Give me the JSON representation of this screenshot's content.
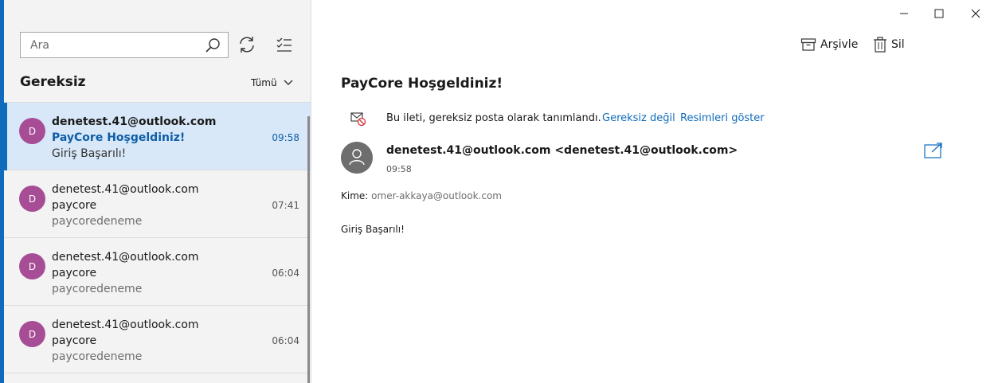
{
  "search": {
    "placeholder": "Ara"
  },
  "folder": {
    "title": "Gereksiz",
    "filter_label": "Tümü"
  },
  "messages": [
    {
      "avatar_letter": "D",
      "sender": "denetest.41@outlook.com",
      "subject": "PayCore Hoşgeldiniz!",
      "preview": "Giriş Başarılı!",
      "time": "09:58",
      "selected": true
    },
    {
      "avatar_letter": "D",
      "sender": "denetest.41@outlook.com",
      "subject": "paycore",
      "preview": "paycoredeneme",
      "time": "07:41",
      "selected": false
    },
    {
      "avatar_letter": "D",
      "sender": "denetest.41@outlook.com",
      "subject": "paycore",
      "preview": "paycoredeneme",
      "time": "06:04",
      "selected": false
    },
    {
      "avatar_letter": "D",
      "sender": "denetest.41@outlook.com",
      "subject": "paycore",
      "preview": "paycoredeneme",
      "time": "06:04",
      "selected": false
    }
  ],
  "toolbar": {
    "archive_label": "Arşivle",
    "delete_label": "Sil"
  },
  "reading": {
    "subject": "PayCore Hoşgeldiniz!",
    "junk_notice": "Bu ileti, gereksiz posta olarak tanımlandı.",
    "not_junk_link": "Gereksiz değil",
    "show_images_link": "Resimleri göster",
    "sender_line": "denetest.41@outlook.com <denetest.41@outlook.com>",
    "time": "09:58",
    "to_label": "Kime:",
    "to_address": "omer-akkaya@outlook.com",
    "body": "Giriş Başarılı!"
  },
  "colors": {
    "accent": "#0f6cbd",
    "selected_bg": "#d8e8f8",
    "avatar": "#a64d96"
  },
  "icons": [
    "search-icon",
    "refresh-icon",
    "select-mode-icon",
    "chevron-down-icon",
    "minimize-icon",
    "maximize-icon",
    "close-icon",
    "archive-icon",
    "trash-icon",
    "more-icon",
    "junk-mail-icon",
    "person-icon",
    "popout-icon"
  ]
}
